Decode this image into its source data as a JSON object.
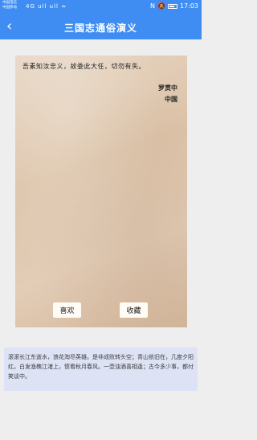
{
  "status_bar": {
    "carrier_line1": "中国电信",
    "carrier_line2": "中国移动",
    "left_icons": "4G ull ull ≈",
    "time": "17:03"
  },
  "nav": {
    "back_glyph": "‹",
    "title": "三国志通俗演义"
  },
  "paper": {
    "quote": "吾素知汝忠义，故委此大任，切勿有失。",
    "author_line1": "罗贯中",
    "author_line2": "中国"
  },
  "buttons": {
    "like": "喜欢",
    "favorite": "收藏"
  },
  "card": {
    "text": "滚滚长江东逝水，浪花淘尽英雄。是非成败转头空；青山依旧在，几度夕阳红。白发渔樵江渚上，惯看秋月春风。一壶浊酒喜相逢；古今多少事，都付笑谈中。"
  },
  "colors": {
    "primary": "#3f8df2",
    "card_bg": "#dde3f4",
    "page_bg": "#eeeeee"
  }
}
